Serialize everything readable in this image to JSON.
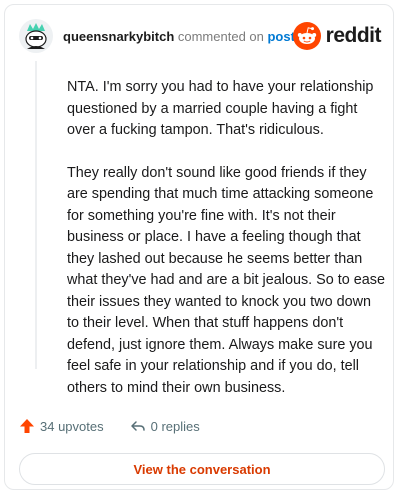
{
  "header": {
    "username": "queensnarkybitch",
    "action_text": " commented on ",
    "post_link": "post",
    "brand_name": "reddit",
    "icons": {
      "avatar": "snoo-avatar",
      "brand": "reddit-snoo-icon"
    }
  },
  "comment": {
    "paragraphs": [
      "NTA. I'm sorry you had to have your relationship questioned by a married couple having a fight over a fucking tampon. That's ridiculous.",
      "They really don't sound like good friends if they are spending that much time attacking someone for something you're fine with. It's not their business or place. I have a feeling though that they lashed out because he seems better than what they've had and are a bit jealous. So to ease their issues they wanted to knock you two down to their level. When that stuff happens don't defend, just ignore them. Always make sure you feel safe in your relationship and if you do, tell others to mind their own business."
    ]
  },
  "actions": {
    "upvotes": "34 upvotes",
    "replies": "0 replies",
    "icons": {
      "upvote": "upvote-arrow-icon",
      "reply": "reply-arrow-icon"
    }
  },
  "cta": {
    "label": "View the conversation"
  },
  "colors": {
    "accent": "#d93a00",
    "brand": "#ff4500",
    "link": "#0079d3"
  }
}
